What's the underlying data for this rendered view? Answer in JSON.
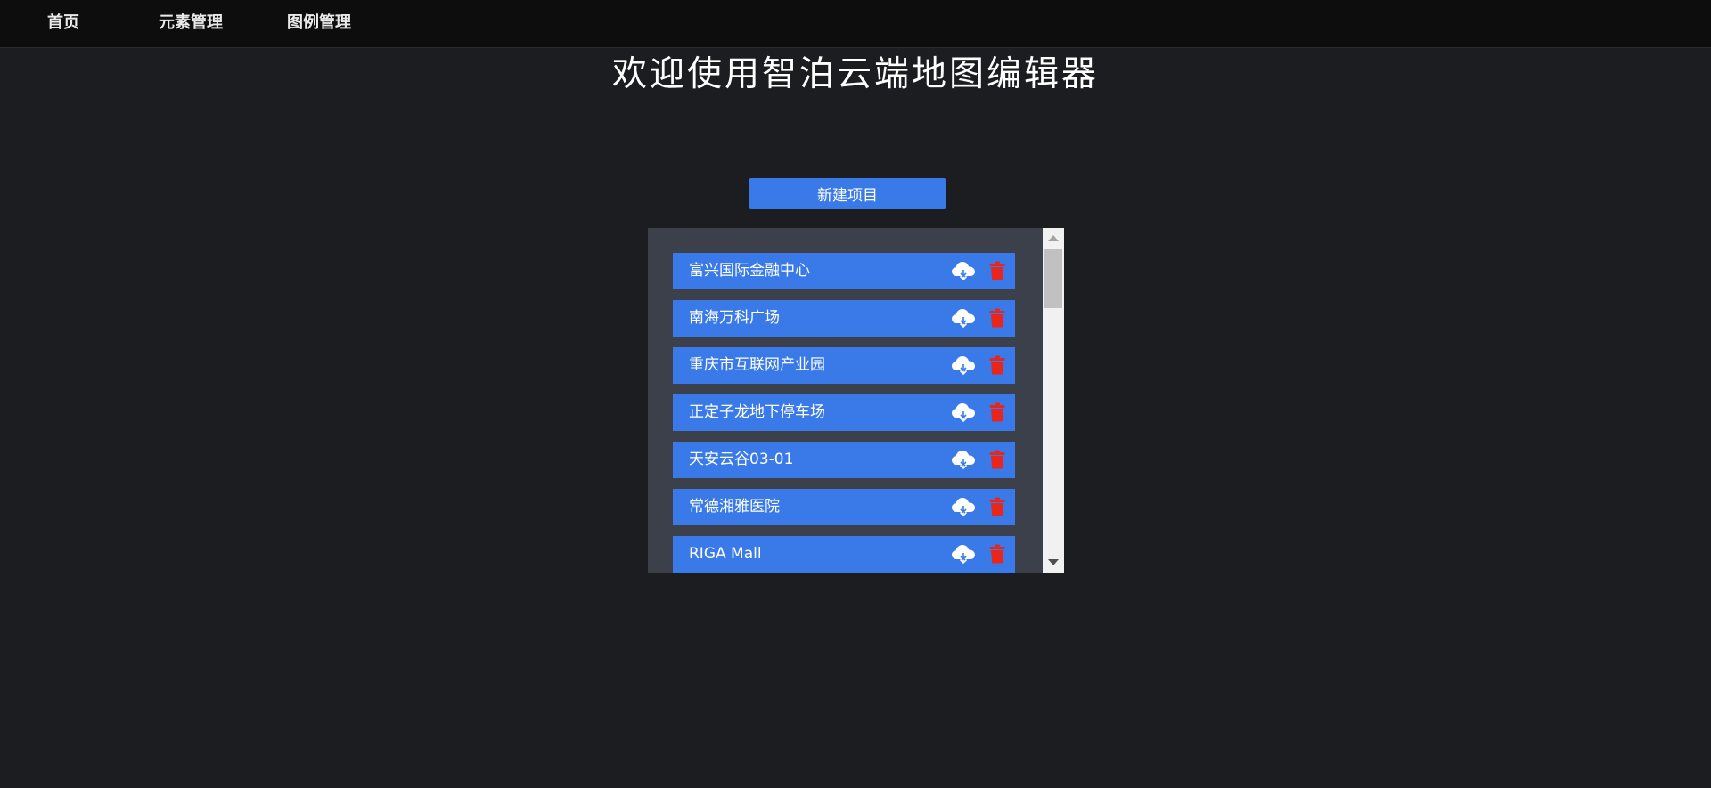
{
  "nav": {
    "items": [
      {
        "label": "首页"
      },
      {
        "label": "元素管理"
      },
      {
        "label": "图例管理"
      }
    ]
  },
  "page": {
    "title": "欢迎使用智泊云端地图编辑器"
  },
  "actions": {
    "new_project_label": "新建项目"
  },
  "projects": [
    {
      "name": "富兴国际金融中心"
    },
    {
      "name": "南海万科广场"
    },
    {
      "name": "重庆市互联网产业园"
    },
    {
      "name": "正定子龙地下停车场"
    },
    {
      "name": "天安云谷03-01"
    },
    {
      "name": "常德湘雅医院"
    },
    {
      "name": "RIGA Mall"
    }
  ],
  "icons": {
    "download": "cloud-download-icon",
    "delete": "trash-icon"
  },
  "colors": {
    "background": "#1c1d21",
    "topbar": "#0d0d0e",
    "accent": "#3a7ae8",
    "panel": "#3c404b",
    "delete": "#e8261c"
  }
}
